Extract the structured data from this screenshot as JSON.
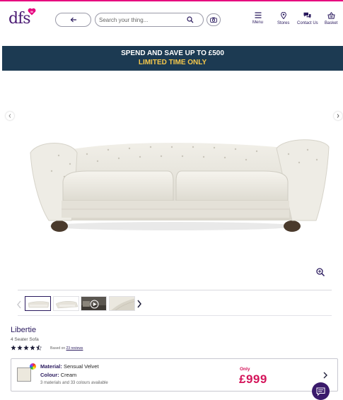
{
  "header": {
    "logo_text": "dfs",
    "logo_badge": "50",
    "search": {
      "placeholder": "Search your thing..."
    },
    "nav": [
      {
        "label": "Menu",
        "icon": "hamburger-icon"
      },
      {
        "label": "Stores",
        "icon": "location-pin-icon"
      },
      {
        "label": "Contact Us",
        "icon": "chat-bubbles-icon"
      },
      {
        "label": "Basket",
        "icon": "basket-icon"
      }
    ]
  },
  "promo": {
    "line1": "SPEND AND SAVE UP TO £500",
    "line2": "LIMITED TIME ONLY"
  },
  "gallery": {
    "zoom_icon": "zoom-in-icon",
    "thumbnails": [
      {
        "kind": "image",
        "selected": true
      },
      {
        "kind": "image",
        "selected": false
      },
      {
        "kind": "video",
        "selected": false
      },
      {
        "kind": "image",
        "selected": false
      }
    ]
  },
  "product": {
    "name": "Libertie",
    "type": "4 Seater Sofa",
    "rating": 4.5,
    "reviews_prefix": "Based on",
    "reviews_link": "23 reviews",
    "material_label": "Material:",
    "material_value": "Sensual Velvet",
    "colour_label": "Colour:",
    "colour_value": "Cream",
    "options_summary": "3 materials and 33 colours available",
    "price_prefix": "Only",
    "price": "£999"
  },
  "colors": {
    "brand_purple": "#2a1a5e",
    "banner_bg": "#1c3a52",
    "banner_accent": "#f5c84c",
    "price_pink": "#d4145a",
    "swatch": "#ece8dd"
  }
}
